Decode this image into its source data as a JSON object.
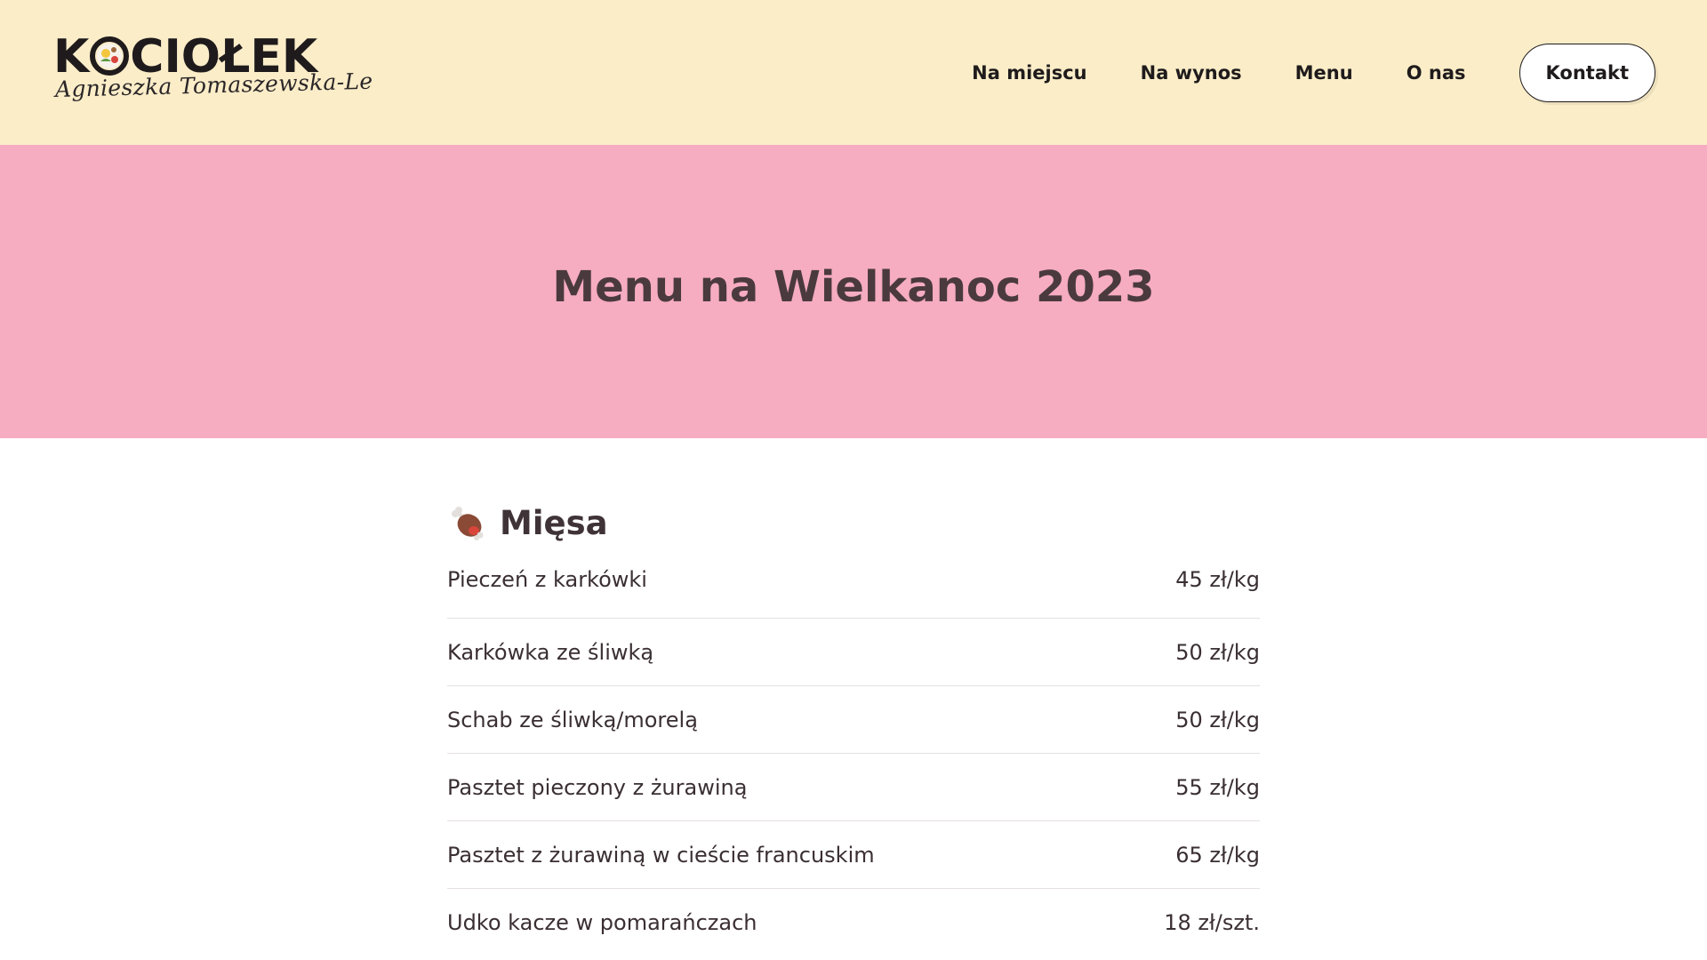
{
  "header": {
    "logo": {
      "word": "KOCIOŁEK",
      "word_before": "K",
      "word_after": "CIOŁEK",
      "subtitle": "Agnieszka Tomaszewska-Le"
    },
    "nav": [
      {
        "label": "Na miejscu"
      },
      {
        "label": "Na wynos"
      },
      {
        "label": "Menu"
      },
      {
        "label": "O nas"
      }
    ],
    "contact_label": "Kontakt"
  },
  "hero": {
    "title": "Menu na Wielkanoc 2023"
  },
  "section": {
    "icon": "meat-on-bone-icon",
    "title": "Mięsa",
    "items": [
      {
        "name": "Pieczeń z karkówki",
        "price": "45 zł/kg"
      },
      {
        "name": "Karkówka ze śliwką",
        "price": "50 zł/kg"
      },
      {
        "name": "Schab ze śliwką/morelą",
        "price": "50 zł/kg"
      },
      {
        "name": "Pasztet pieczony z żurawiną",
        "price": "55 zł/kg"
      },
      {
        "name": "Pasztet z żurawiną w cieście francuskim",
        "price": "65 zł/kg"
      },
      {
        "name": "Udko kacze w pomarańczach",
        "price": "18 zł/szt."
      }
    ]
  },
  "colors": {
    "header_bg": "#faedc8",
    "hero_bg": "#f6acc1",
    "text_dark": "#1f1b1c",
    "text_body": "#3a2f33"
  }
}
